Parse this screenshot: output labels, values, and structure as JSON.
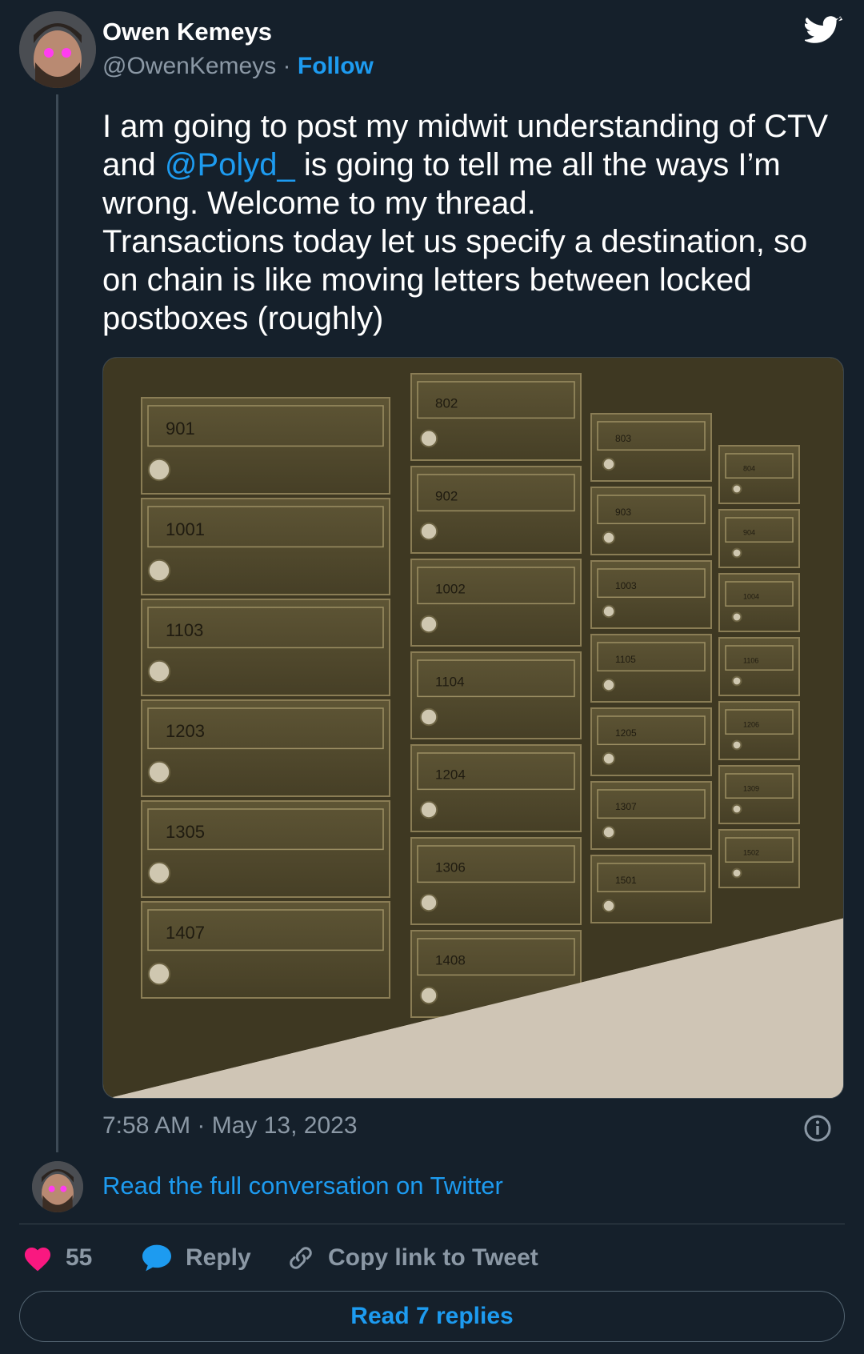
{
  "author": {
    "name": "Owen Kemeys",
    "handle": "@OwenKemeys",
    "separator": "·",
    "follow_label": "Follow"
  },
  "tweet": {
    "line1_before": "I am going to post my midwit understanding of CTV and ",
    "mention": "@Polyd_",
    "line1_after": " is going to tell me all the ways I’m wrong. Welcome to my thread.",
    "line2": "Transactions today let us specify a destination, so on chain is like moving letters between locked postboxes (roughly)"
  },
  "photo": {
    "mailbox_numbers": [
      [
        "901",
        "1001",
        "1103",
        "1203",
        "1305",
        "1407"
      ],
      [
        "802",
        "902",
        "1002",
        "1104",
        "1204",
        "1306",
        "1408"
      ],
      [
        "803",
        "903",
        "1003",
        "1105",
        "1205",
        "1307",
        "1501"
      ],
      [
        "804",
        "904",
        "1004",
        "1106",
        "1206",
        "1309",
        "1502"
      ]
    ]
  },
  "timestamp": "7:58 AM · May 13, 2023",
  "read_full_label": "Read the full conversation on Twitter",
  "actions": {
    "like_count": "55",
    "reply_label": "Reply",
    "copy_label": "Copy link to Tweet"
  },
  "read_replies_label": "Read 7 replies",
  "colors": {
    "background": "#15202b",
    "accent": "#1d9bf0",
    "like": "#f91880",
    "muted": "#8b98a5"
  }
}
